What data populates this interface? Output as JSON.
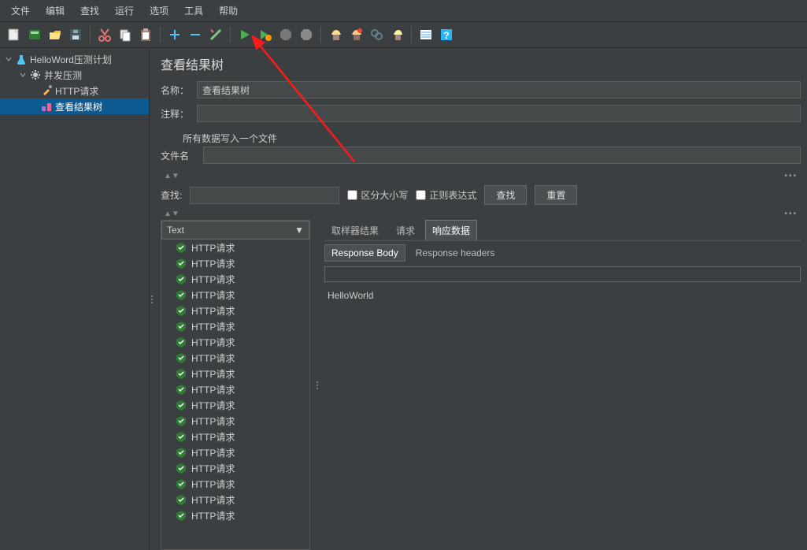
{
  "menu": [
    "文件",
    "编辑",
    "查找",
    "运行",
    "选项",
    "工具",
    "帮助"
  ],
  "tree": {
    "plan": "HelloWord压测计划",
    "thread_group": "并发压测",
    "sampler": "HTTP请求",
    "listener": "查看结果树"
  },
  "panel": {
    "title": "查看结果树",
    "name_label": "名称：",
    "name_value": "查看结果树",
    "comment_label": "注释：",
    "comment_value": "",
    "write_all_label": "所有数据写入一个文件",
    "filename_label": "文件名",
    "filename_value": ""
  },
  "search": {
    "label": "查找:",
    "value": "",
    "case_label": "区分大小写",
    "regex_label": "正则表达式",
    "search_btn": "查找",
    "reset_btn": "重置"
  },
  "results": {
    "combo_value": "Text",
    "items": [
      "HTTP请求",
      "HTTP请求",
      "HTTP请求",
      "HTTP请求",
      "HTTP请求",
      "HTTP请求",
      "HTTP请求",
      "HTTP请求",
      "HTTP请求",
      "HTTP请求",
      "HTTP请求",
      "HTTP请求",
      "HTTP请求",
      "HTTP请求",
      "HTTP请求",
      "HTTP请求",
      "HTTP请求",
      "HTTP请求"
    ]
  },
  "detail": {
    "tabs": [
      "取样器结果",
      "请求",
      "响应数据"
    ],
    "subtabs": [
      "Response Body",
      "Response headers"
    ],
    "body": "HelloWorld"
  }
}
